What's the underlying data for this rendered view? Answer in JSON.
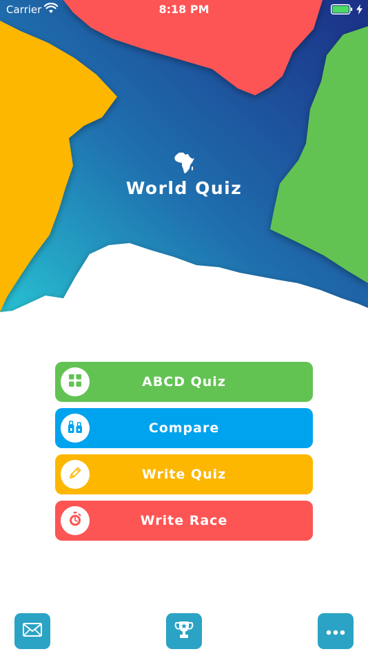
{
  "status_bar": {
    "carrier": "Carrier",
    "time": "8:18 PM"
  },
  "app": {
    "title": "World Quiz",
    "logo_icon": "africa-continent-icon"
  },
  "menu": {
    "items": [
      {
        "label": "ABCD Quiz",
        "icon": "grid-icon",
        "color": "#62c353"
      },
      {
        "label": "Compare",
        "icon": "scales-icon",
        "color": "#00a3ee"
      },
      {
        "label": "Write Quiz",
        "icon": "pencil-icon",
        "color": "#fdb701"
      },
      {
        "label": "Write Race",
        "icon": "stopwatch-icon",
        "color": "#fd5554"
      }
    ]
  },
  "bottom_bar": {
    "mail_icon": "mail-icon",
    "trophy_icon": "trophy-icon",
    "more_icon": "more-icon",
    "button_color": "#2ba3c4"
  },
  "theme": {
    "hero_gradient_top": "#1b2f86",
    "hero_gradient_bottom": "#28c7d4",
    "red_shape": "#fd5554",
    "yellow_shape": "#fdb701",
    "green_shape": "#62c353"
  }
}
